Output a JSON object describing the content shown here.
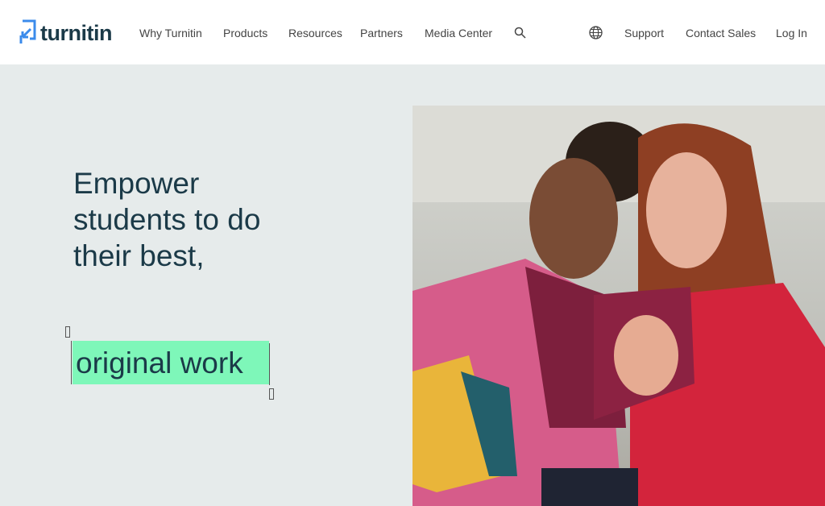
{
  "brand": {
    "name": "turnitin",
    "accent": "#3b8beb"
  },
  "nav": {
    "items": [
      "Why Turnitin",
      "Products",
      "Resources",
      "Partners",
      "Media Center"
    ],
    "search_icon": "search-icon",
    "globe_icon": "globe-icon",
    "support": "Support",
    "contact": "Contact Sales",
    "login": "Log In"
  },
  "hero": {
    "lines": [
      "Empower",
      "students to do",
      "their best,"
    ],
    "highlight": "original work",
    "highlight_color": "#7ef7b9"
  }
}
